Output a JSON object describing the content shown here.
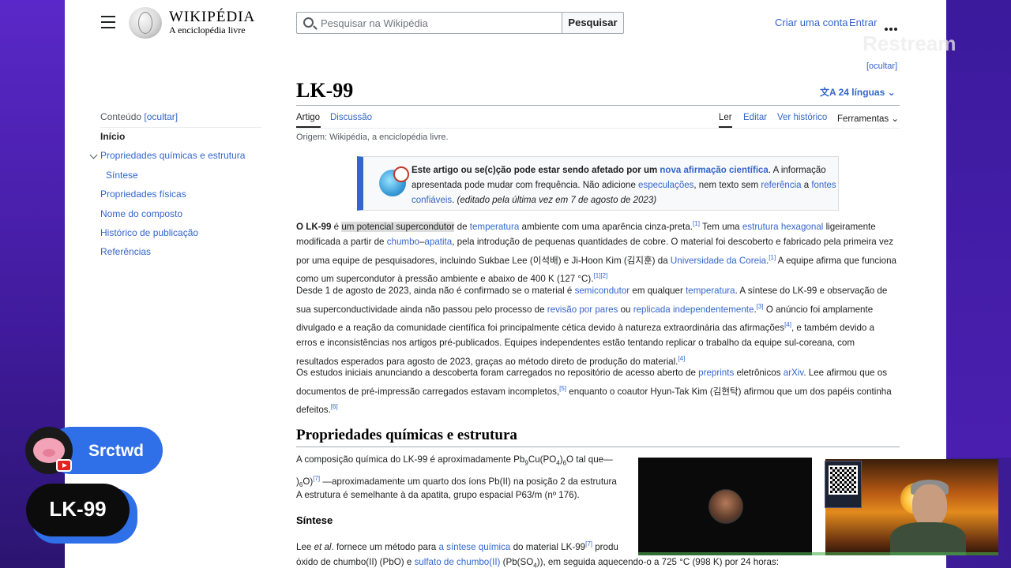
{
  "header": {
    "logo_title": "WIKIPÉDIA",
    "logo_tagline": "A enciclopédia livre",
    "search_placeholder": "Pesquisar na Wikipédia",
    "search_button": "Pesquisar",
    "create_account": "Criar uma conta",
    "login": "Entrar",
    "hide": "[ocultar]"
  },
  "toc": {
    "label": "Conteúdo",
    "hide": "[ocultar]",
    "items": [
      "Início",
      "Propriedades químicas e estrutura",
      "Síntese",
      "Propriedades físicas",
      "Nome do composto",
      "Histórico de publicação",
      "Referências"
    ]
  },
  "article": {
    "title": "LK-99",
    "languages": "24 línguas",
    "tabs": {
      "article": "Artigo",
      "talk": "Discussão",
      "read": "Ler",
      "edit": "Editar",
      "history": "Ver histórico",
      "tools": "Ferramentas"
    },
    "origin": "Origem: Wikipédia, a enciclopédia livre.",
    "notice": {
      "t1": "Este artigo ou se(c)ção pode estar sendo afetado por um ",
      "link1": "nova afirmação científica",
      "t2": ". A informação apresentada pode mudar com frequência. Não adicione ",
      "link2": "especulações",
      "t3": ", nem texto sem ",
      "link3": "referência",
      "t4": " a ",
      "link4": "fontes confiáveis",
      "t5": ". ",
      "edited": "(editado pela última vez em 7 de agosto de 2023)"
    },
    "p1": {
      "b": "O LK-99",
      "a": " é ",
      "hl": "um potencial supercondutor",
      "c": " de ",
      "l1": "temperatura",
      "d": " ambiente com uma aparência cinza-preta.",
      "r1": "[1]",
      "e": " Tem uma ",
      "l2": "estrutura hexagonal",
      "f": " ligeiramente modificada a partir de ",
      "l3": "chumbo",
      "g": "–",
      "l4": "apatita",
      "h": ", pela introdução de pequenas quantidades de cobre. O material foi descoberto e fabricado pela primeira vez por uma equipe de pesquisadores, incluindo Sukbae Lee (이석배) e Ji-Hoon Kim (김지훈) da ",
      "l5": "Universidade da Coreia",
      "i": ".",
      "r2": "[1]",
      "j": " A equipe afirma que funciona como um supercondutor à pressão ambiente e abaixo de 400 K (127 °C).",
      "r3": "[1][2]"
    },
    "p2": {
      "a": "Desde 1 de agosto de 2023, ainda não é confirmado se o material é ",
      "l1": "semicondutor",
      "b": " em qualquer ",
      "l2": "temperatura",
      "c": ". A síntese do LK-99 e observação de sua superconductividade ainda não passou pelo processo de ",
      "l3": "revisão por pares",
      "d": " ou ",
      "l4": "replicada independentemente",
      "e": ".",
      "r1": "[3]",
      "f": " O anúncio foi amplamente divulgado e a reação da comunidade científica foi principalmente cética devido à natureza extraordinária das afirmações",
      "r2": "[4]",
      "g": ", e também devido a erros e inconsistências nos artigos pré-publicados. Equipes independentes estão tentando replicar o trabalho da equipe sul-coreana, com resultados esperados para agosto de 2023, graças ao método direto de produção do material.",
      "r3": "[4]"
    },
    "p3": {
      "a": "Os estudos iniciais anunciando a descoberta foram carregados no repositório de acesso aberto de ",
      "l1": "preprints",
      "b": " eletrônicos ",
      "l2": "arXiv",
      "c": ". Lee afirmou que os documentos de pré-impressão carregados estavam incompletos,",
      "r1": "[5]",
      "d": " enquanto o coautor Hyun-Tak Kim (김현탁) afirmou que um dos papéis continha defeitos.",
      "r2": "[6]"
    },
    "h2": "Propriedades químicas e estrutura",
    "p4": {
      "a": "A composição química do LK-99 é aproximadamente Pb",
      "s1": "9",
      "b": "Cu(PO",
      "s2": "4",
      "c": ")",
      "s3": "6",
      "d": "O tal que—",
      "e": ")",
      "s4": "6",
      "f": "O)",
      "r1": "[7]",
      "g": " —aproximadamente um quarto dos íons Pb(II) na posição 2 da estrutura"
    },
    "p5": "A estrutura é semelhante à da apatita, grupo espacial P63/m (nº 176).",
    "h3": "Síntese",
    "p6": {
      "a": "Lee ",
      "i": "et al",
      "b": ". fornece um método para ",
      "l1": "a síntese química",
      "c": " do material LK-99",
      "r1": "[7]",
      "d": " produ",
      "e": "óxido de chumbo(II) (PbO) e ",
      "l2": "sulfato de chumbo(II)",
      "f": " (Pb(SO",
      "s1": "4",
      "g": ")), em seguida aquecendo-o a 725 °C (998 K) por 24 horas:"
    }
  },
  "overlay": {
    "watermark": "Restream",
    "user_name": "Srctwd",
    "stream_title": "LK-99"
  },
  "colors": {
    "link": "#3366cc",
    "badge_blue": "#2f6fe8",
    "notice_bar": "#3366cc"
  }
}
